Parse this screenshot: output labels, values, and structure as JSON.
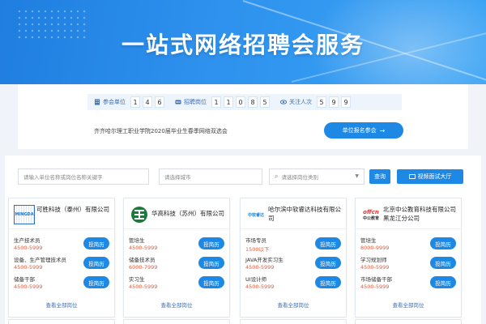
{
  "banner": {
    "title": "一站式网络招聘会服务"
  },
  "stats": {
    "companies": {
      "label": "参会单位",
      "digits": [
        "1",
        "4",
        "6"
      ]
    },
    "positions": {
      "label": "招聘岗位",
      "digits": [
        "1",
        "1",
        "0",
        "8",
        "5"
      ]
    },
    "followers": {
      "label": "关注人次",
      "digits": [
        "5",
        "9",
        "9"
      ]
    }
  },
  "fair": {
    "name": "齐齐哈尔理工职业学院2020届毕业生春季网络双选会",
    "register_label": "单位报名参会",
    "register_arrow": "→"
  },
  "search": {
    "keyword_placeholder": "请输入单位名称或岗位名称关键字",
    "city_placeholder": "请选择城市",
    "category_placeholder": "请选择岗位类别",
    "query_label": "查询",
    "video_label": "视频面试大厅"
  },
  "companies": [
    {
      "name": "可胜科技（泰州）有限公司",
      "logo_text": "MINGDA",
      "logo_color": "#2a6fc1",
      "jobs": [
        {
          "title": "生产技术员",
          "salary": "4500-5999"
        },
        {
          "title": "设备、生产管理技术员",
          "salary": "4500-5999"
        },
        {
          "title": "储备干部",
          "salary": "4500-5999"
        }
      ]
    },
    {
      "name": "华高科技（苏州）有限公司",
      "logo_text": "华高",
      "logo_color": "#1e7a3a",
      "jobs": [
        {
          "title": "管培生",
          "salary": "4500-5999"
        },
        {
          "title": "储备技术员",
          "salary": "6000-7999"
        },
        {
          "title": "实习生",
          "salary": "4500-5999"
        }
      ]
    },
    {
      "name": "哈尔滨中软睿达科技有限公司",
      "logo_text": "中软睿达",
      "logo_color": "#1e88e5",
      "jobs": [
        {
          "title": "市场专员",
          "salary": "1500以下"
        },
        {
          "title": "JAVA开发实习生",
          "salary": "4500-5999"
        },
        {
          "title": "UI设计师",
          "salary": "4500-5999"
        }
      ]
    },
    {
      "name": "北京中公教育科技有限公司黑龙江分公司",
      "logo_text": "offcn",
      "logo_sub": "中公教育",
      "logo_color": "#e8393a",
      "jobs": [
        {
          "title": "管培生",
          "salary": "8000-9999"
        },
        {
          "title": "学习规划师",
          "salary": "4500-5999"
        },
        {
          "title": "市场储备干部",
          "salary": "4500-5999"
        }
      ]
    }
  ],
  "labels": {
    "apply": "投简历",
    "view_all": "查看全部岗位"
  },
  "colors": {
    "primary": "#1e88e5",
    "salary": "#e8593a",
    "banner": "#2e92ee"
  }
}
